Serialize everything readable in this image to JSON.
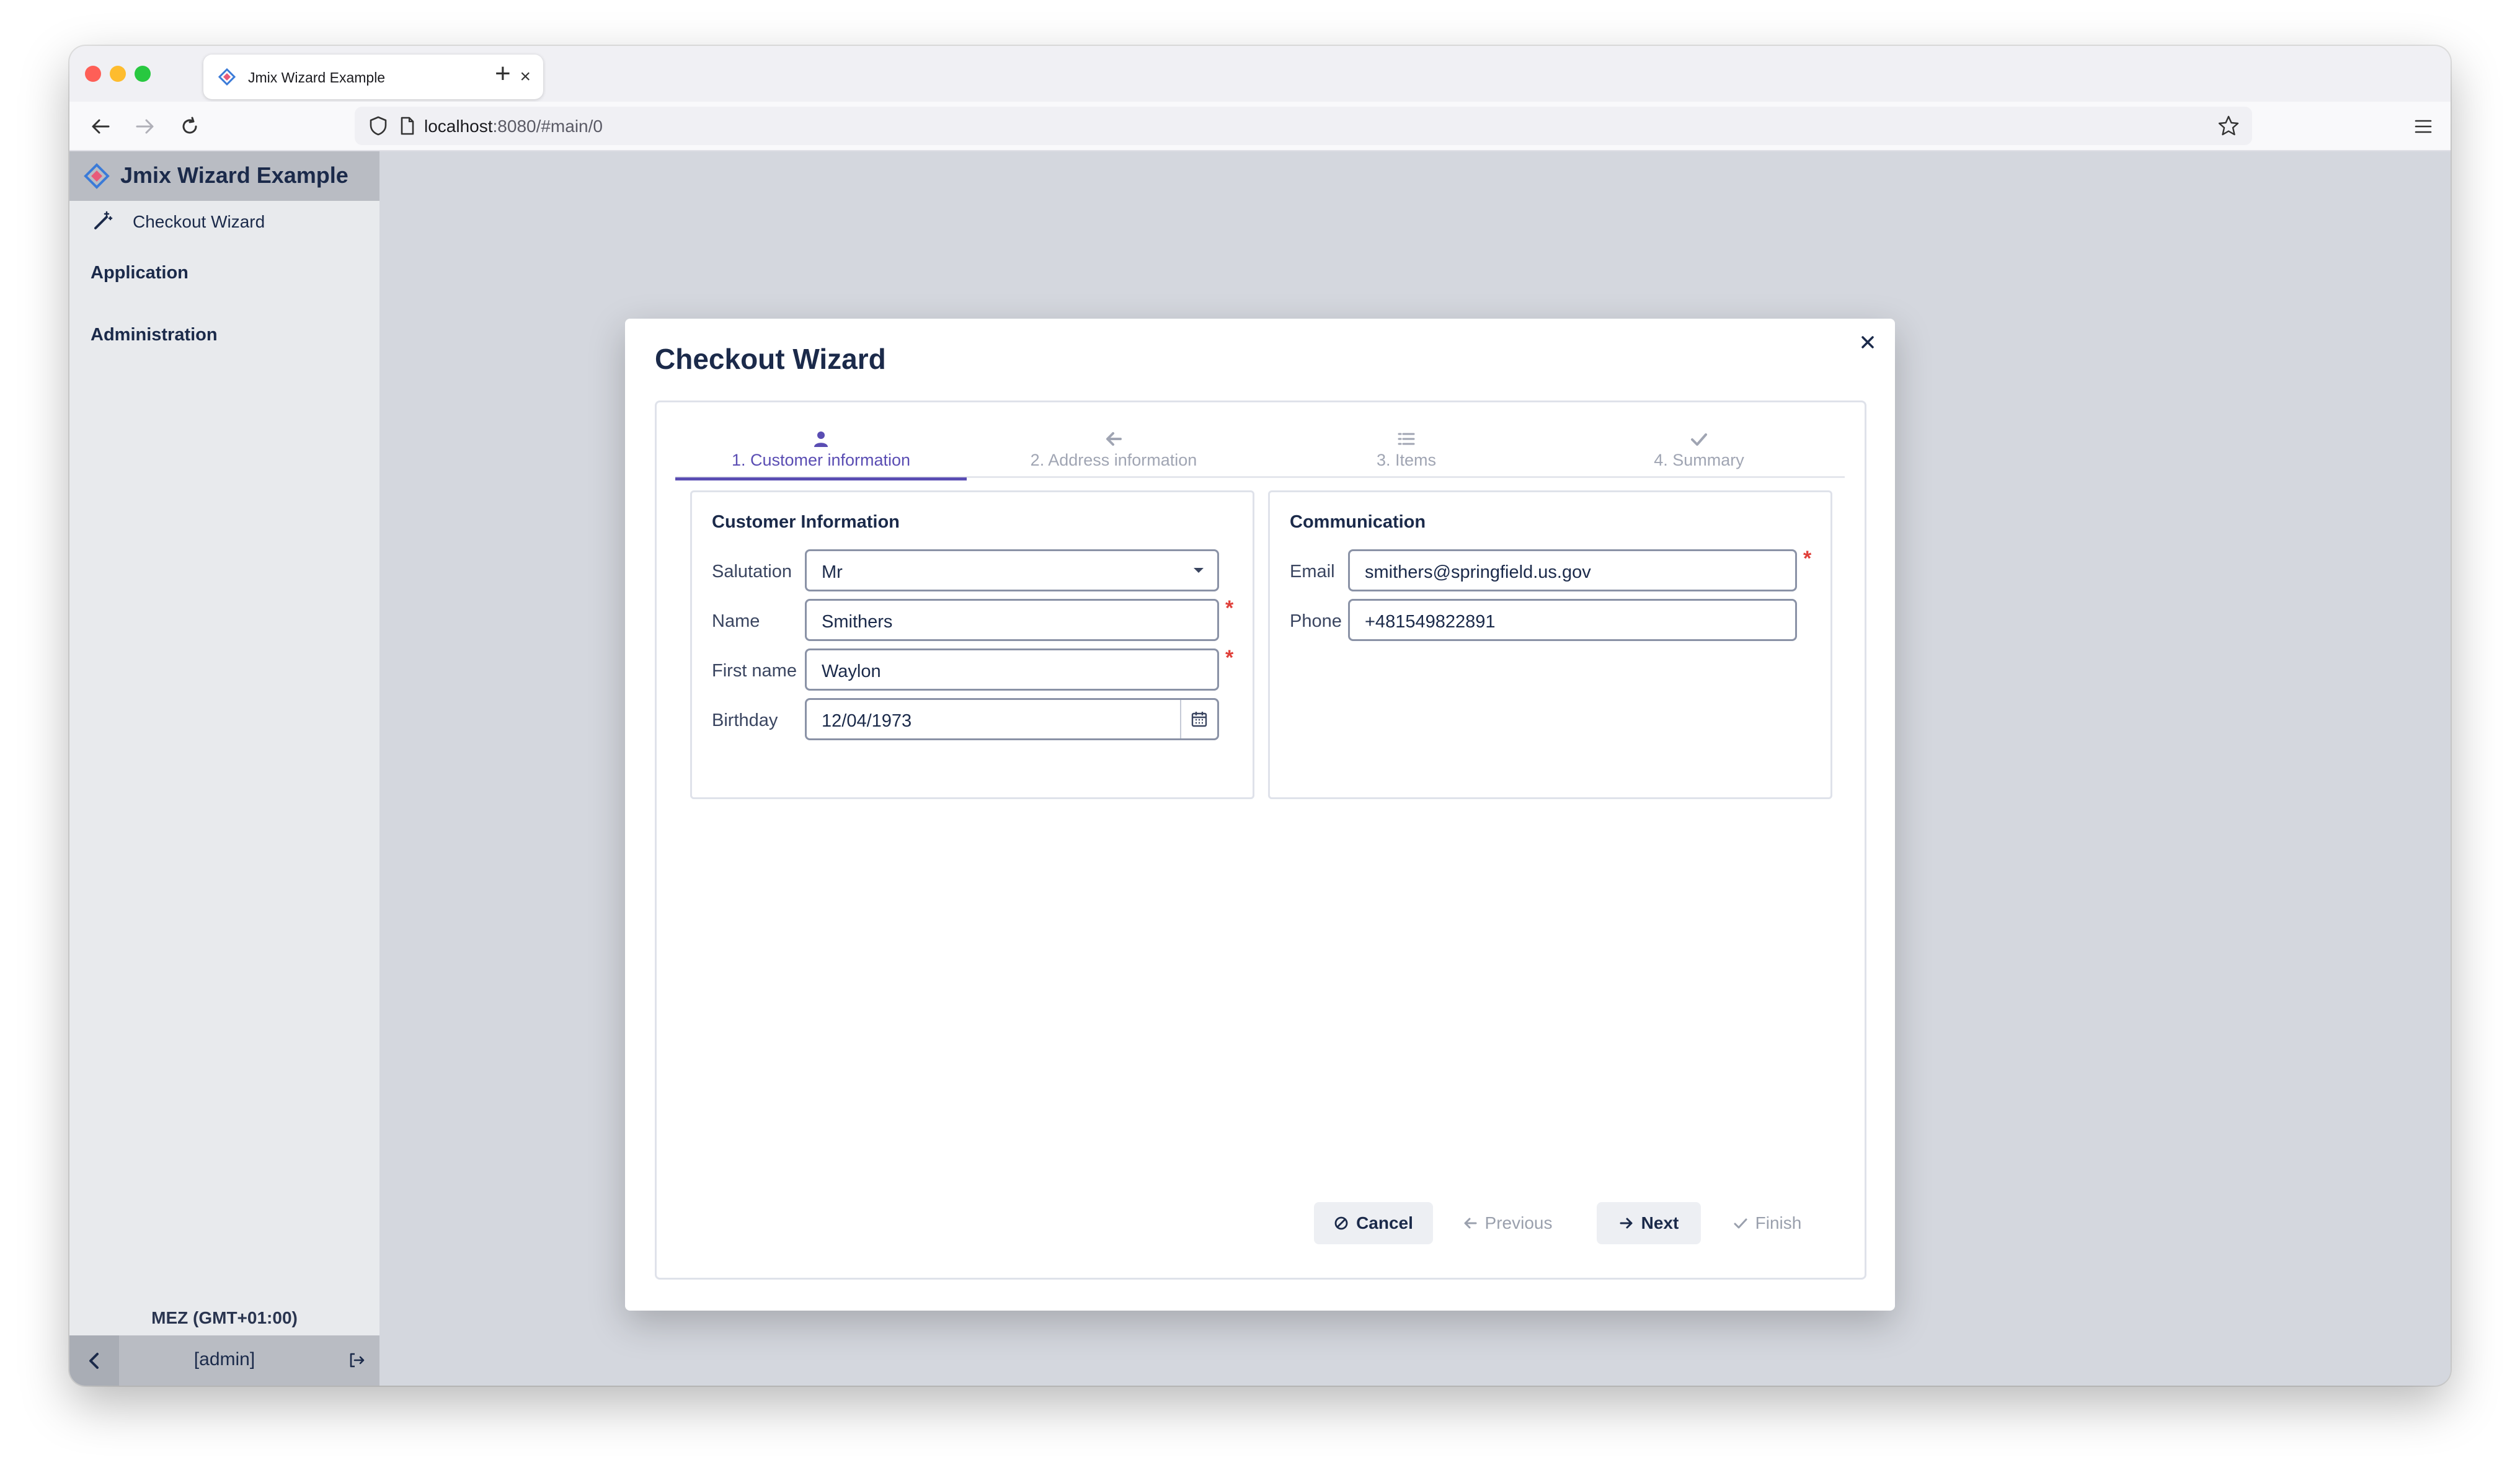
{
  "browser": {
    "tab_title": "Jmix Wizard Example",
    "tab_close": "×",
    "new_tab": "+",
    "url_host": "localhost",
    "url_path": ":8080/#main/0"
  },
  "sidebar": {
    "app_title": "Jmix Wizard Example",
    "menu_item": "Checkout Wizard",
    "groups": [
      "Application",
      "Administration"
    ],
    "timezone": "MEZ (GMT+01:00)",
    "user": "[admin]"
  },
  "dialog": {
    "title": "Checkout Wizard",
    "steps": [
      {
        "label": "1. Customer information",
        "icon": "user-icon",
        "active": true
      },
      {
        "label": "2. Address information",
        "icon": "arrow-left-icon",
        "active": false
      },
      {
        "label": "3. Items",
        "icon": "list-icon",
        "active": false
      },
      {
        "label": "4. Summary",
        "icon": "check-icon",
        "active": false
      }
    ],
    "customer": {
      "title": "Customer Information",
      "salutation_label": "Salutation",
      "salutation_value": "Mr",
      "name_label": "Name",
      "name_value": "Smithers",
      "first_name_label": "First name",
      "first_name_value": "Waylon",
      "birthday_label": "Birthday",
      "birthday_value": "12/04/1973"
    },
    "communication": {
      "title": "Communication",
      "email_label": "Email",
      "email_value": "smithers@springfield.us.gov",
      "phone_label": "Phone",
      "phone_value": "+481549822891"
    },
    "required_mark": "*",
    "buttons": {
      "cancel": "Cancel",
      "previous": "Previous",
      "next": "Next",
      "finish": "Finish"
    }
  },
  "colors": {
    "accent": "#5a4db3",
    "required": "#e0403a",
    "text": "#1b2a4a"
  }
}
